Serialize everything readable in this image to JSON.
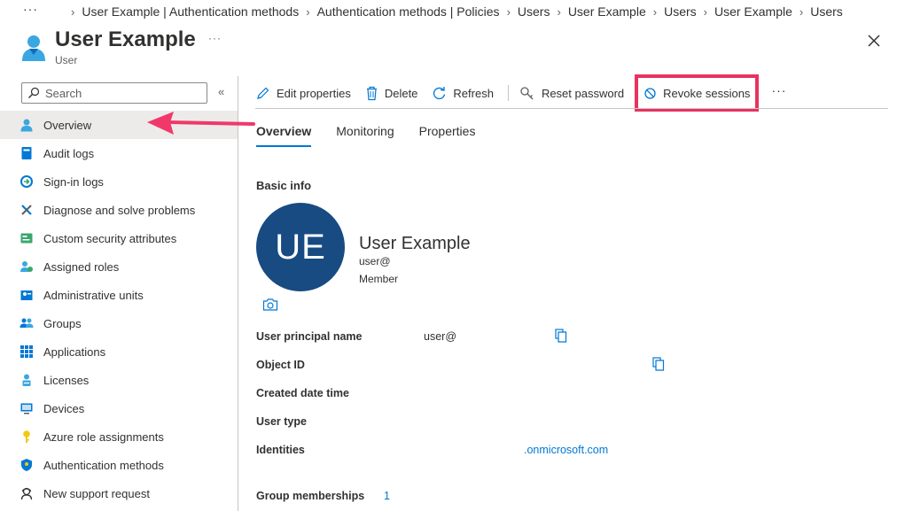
{
  "breadcrumb": {
    "more": "···",
    "items": [
      "User Example | Authentication methods",
      "Authentication methods | Policies",
      "Users",
      "User Example",
      "Users",
      "User Example",
      "Users"
    ]
  },
  "header": {
    "title": "User Example",
    "subtitle": "User",
    "more": "···",
    "close_icon": "close-icon"
  },
  "nav": {
    "search_placeholder": "Search",
    "collapse": "«",
    "items": [
      {
        "label": "Overview",
        "icon": "user-icon",
        "active": true
      },
      {
        "label": "Audit logs",
        "icon": "audit-log-icon"
      },
      {
        "label": "Sign-in logs",
        "icon": "sign-in-icon"
      },
      {
        "label": "Diagnose and solve problems",
        "icon": "wrench-icon"
      },
      {
        "label": "Custom security attributes",
        "icon": "attributes-icon"
      },
      {
        "label": "Assigned roles",
        "icon": "roles-icon"
      },
      {
        "label": "Administrative units",
        "icon": "admin-units-icon"
      },
      {
        "label": "Groups",
        "icon": "groups-icon"
      },
      {
        "label": "Applications",
        "icon": "apps-grid-icon"
      },
      {
        "label": "Licenses",
        "icon": "license-icon"
      },
      {
        "label": "Devices",
        "icon": "device-icon"
      },
      {
        "label": "Azure role assignments",
        "icon": "key-icon"
      },
      {
        "label": "Authentication methods",
        "icon": "shield-icon"
      },
      {
        "label": "New support request",
        "icon": "support-icon"
      }
    ]
  },
  "commands": {
    "edit": "Edit properties",
    "delete": "Delete",
    "refresh": "Refresh",
    "reset_password": "Reset password",
    "revoke_sessions": "Revoke sessions",
    "more": "···"
  },
  "tabs": [
    {
      "label": "Overview",
      "active": true
    },
    {
      "label": "Monitoring"
    },
    {
      "label": "Properties"
    }
  ],
  "basic_info": {
    "title": "Basic info",
    "initials": "UE",
    "display_name": "User Example",
    "upn_short": "user@",
    "user_type": "Member"
  },
  "properties": {
    "upn_label": "User principal name",
    "upn_value": "user@",
    "object_id_label": "Object ID",
    "created_label": "Created date time",
    "user_type_label": "User type",
    "identities_label": "Identities",
    "identities_value": ".onmicrosoft.com",
    "group_label": "Group memberships",
    "group_value": "1"
  },
  "colors": {
    "accent": "#0078d4",
    "avatar": "#174b82",
    "highlight": "#e8335f"
  }
}
